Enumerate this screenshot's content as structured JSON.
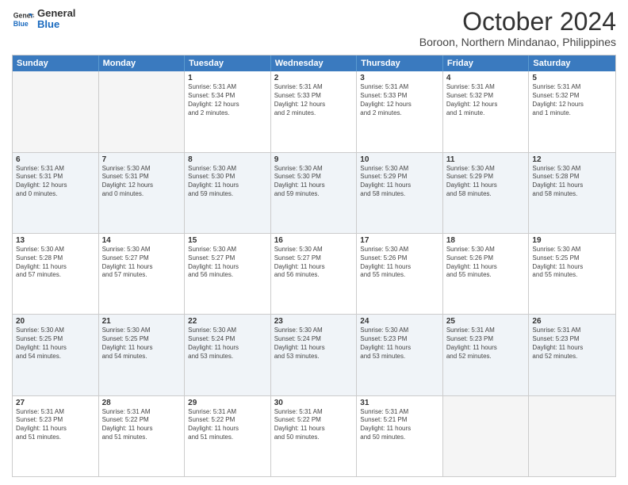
{
  "logo": {
    "general": "General",
    "blue": "Blue"
  },
  "header": {
    "month": "October 2024",
    "location": "Boroon, Northern Mindanao, Philippines"
  },
  "days": [
    "Sunday",
    "Monday",
    "Tuesday",
    "Wednesday",
    "Thursday",
    "Friday",
    "Saturday"
  ],
  "rows": [
    {
      "shaded": false,
      "cells": [
        {
          "day": "",
          "info": ""
        },
        {
          "day": "",
          "info": ""
        },
        {
          "day": "1",
          "info": "Sunrise: 5:31 AM\nSunset: 5:34 PM\nDaylight: 12 hours\nand 2 minutes."
        },
        {
          "day": "2",
          "info": "Sunrise: 5:31 AM\nSunset: 5:33 PM\nDaylight: 12 hours\nand 2 minutes."
        },
        {
          "day": "3",
          "info": "Sunrise: 5:31 AM\nSunset: 5:33 PM\nDaylight: 12 hours\nand 2 minutes."
        },
        {
          "day": "4",
          "info": "Sunrise: 5:31 AM\nSunset: 5:32 PM\nDaylight: 12 hours\nand 1 minute."
        },
        {
          "day": "5",
          "info": "Sunrise: 5:31 AM\nSunset: 5:32 PM\nDaylight: 12 hours\nand 1 minute."
        }
      ]
    },
    {
      "shaded": true,
      "cells": [
        {
          "day": "6",
          "info": "Sunrise: 5:31 AM\nSunset: 5:31 PM\nDaylight: 12 hours\nand 0 minutes."
        },
        {
          "day": "7",
          "info": "Sunrise: 5:30 AM\nSunset: 5:31 PM\nDaylight: 12 hours\nand 0 minutes."
        },
        {
          "day": "8",
          "info": "Sunrise: 5:30 AM\nSunset: 5:30 PM\nDaylight: 11 hours\nand 59 minutes."
        },
        {
          "day": "9",
          "info": "Sunrise: 5:30 AM\nSunset: 5:30 PM\nDaylight: 11 hours\nand 59 minutes."
        },
        {
          "day": "10",
          "info": "Sunrise: 5:30 AM\nSunset: 5:29 PM\nDaylight: 11 hours\nand 58 minutes."
        },
        {
          "day": "11",
          "info": "Sunrise: 5:30 AM\nSunset: 5:29 PM\nDaylight: 11 hours\nand 58 minutes."
        },
        {
          "day": "12",
          "info": "Sunrise: 5:30 AM\nSunset: 5:28 PM\nDaylight: 11 hours\nand 58 minutes."
        }
      ]
    },
    {
      "shaded": false,
      "cells": [
        {
          "day": "13",
          "info": "Sunrise: 5:30 AM\nSunset: 5:28 PM\nDaylight: 11 hours\nand 57 minutes."
        },
        {
          "day": "14",
          "info": "Sunrise: 5:30 AM\nSunset: 5:27 PM\nDaylight: 11 hours\nand 57 minutes."
        },
        {
          "day": "15",
          "info": "Sunrise: 5:30 AM\nSunset: 5:27 PM\nDaylight: 11 hours\nand 56 minutes."
        },
        {
          "day": "16",
          "info": "Sunrise: 5:30 AM\nSunset: 5:27 PM\nDaylight: 11 hours\nand 56 minutes."
        },
        {
          "day": "17",
          "info": "Sunrise: 5:30 AM\nSunset: 5:26 PM\nDaylight: 11 hours\nand 55 minutes."
        },
        {
          "day": "18",
          "info": "Sunrise: 5:30 AM\nSunset: 5:26 PM\nDaylight: 11 hours\nand 55 minutes."
        },
        {
          "day": "19",
          "info": "Sunrise: 5:30 AM\nSunset: 5:25 PM\nDaylight: 11 hours\nand 55 minutes."
        }
      ]
    },
    {
      "shaded": true,
      "cells": [
        {
          "day": "20",
          "info": "Sunrise: 5:30 AM\nSunset: 5:25 PM\nDaylight: 11 hours\nand 54 minutes."
        },
        {
          "day": "21",
          "info": "Sunrise: 5:30 AM\nSunset: 5:25 PM\nDaylight: 11 hours\nand 54 minutes."
        },
        {
          "day": "22",
          "info": "Sunrise: 5:30 AM\nSunset: 5:24 PM\nDaylight: 11 hours\nand 53 minutes."
        },
        {
          "day": "23",
          "info": "Sunrise: 5:30 AM\nSunset: 5:24 PM\nDaylight: 11 hours\nand 53 minutes."
        },
        {
          "day": "24",
          "info": "Sunrise: 5:30 AM\nSunset: 5:23 PM\nDaylight: 11 hours\nand 53 minutes."
        },
        {
          "day": "25",
          "info": "Sunrise: 5:31 AM\nSunset: 5:23 PM\nDaylight: 11 hours\nand 52 minutes."
        },
        {
          "day": "26",
          "info": "Sunrise: 5:31 AM\nSunset: 5:23 PM\nDaylight: 11 hours\nand 52 minutes."
        }
      ]
    },
    {
      "shaded": false,
      "cells": [
        {
          "day": "27",
          "info": "Sunrise: 5:31 AM\nSunset: 5:23 PM\nDaylight: 11 hours\nand 51 minutes."
        },
        {
          "day": "28",
          "info": "Sunrise: 5:31 AM\nSunset: 5:22 PM\nDaylight: 11 hours\nand 51 minutes."
        },
        {
          "day": "29",
          "info": "Sunrise: 5:31 AM\nSunset: 5:22 PM\nDaylight: 11 hours\nand 51 minutes."
        },
        {
          "day": "30",
          "info": "Sunrise: 5:31 AM\nSunset: 5:22 PM\nDaylight: 11 hours\nand 50 minutes."
        },
        {
          "day": "31",
          "info": "Sunrise: 5:31 AM\nSunset: 5:21 PM\nDaylight: 11 hours\nand 50 minutes."
        },
        {
          "day": "",
          "info": ""
        },
        {
          "day": "",
          "info": ""
        }
      ]
    }
  ]
}
